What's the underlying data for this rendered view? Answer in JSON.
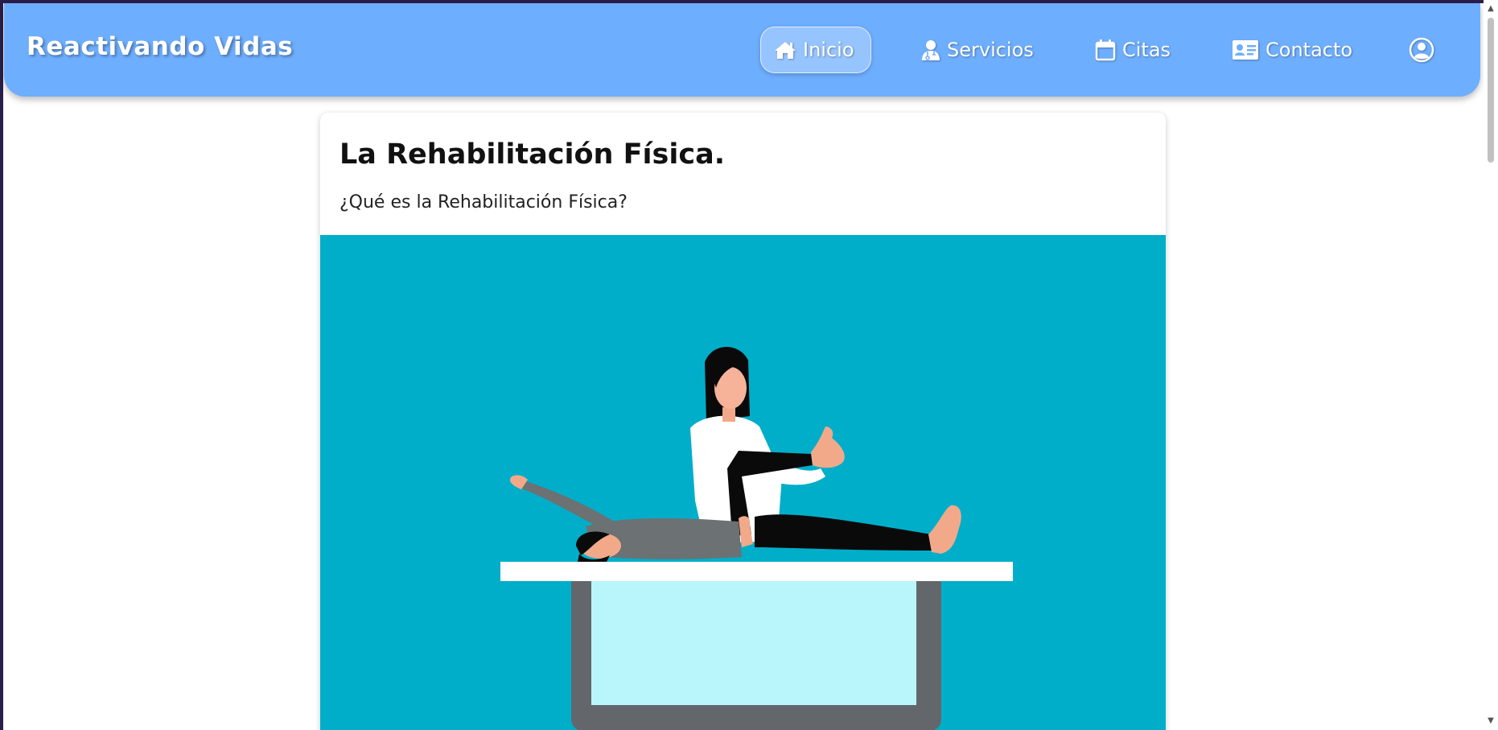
{
  "brand": "Reactivando Vidas",
  "nav": {
    "items": [
      {
        "label": "Inicio",
        "icon": "home-icon",
        "active": true
      },
      {
        "label": "Servicios",
        "icon": "doctor-icon",
        "active": false
      },
      {
        "label": "Citas",
        "icon": "calendar-icon",
        "active": false
      },
      {
        "label": "Contacto",
        "icon": "id-card-icon",
        "active": false
      }
    ],
    "user_icon": "user-circle-icon"
  },
  "card": {
    "title": "La Rehabilitación Física.",
    "subtitle": "¿Qué es la Rehabilitación Física?",
    "image_icon": "physiotherapy-illustration"
  },
  "colors": {
    "navbar": "#6eaefe",
    "illustration_bg": "#00aec9",
    "table_cloth": "#b9f6fb",
    "table_frame": "#63676b"
  }
}
